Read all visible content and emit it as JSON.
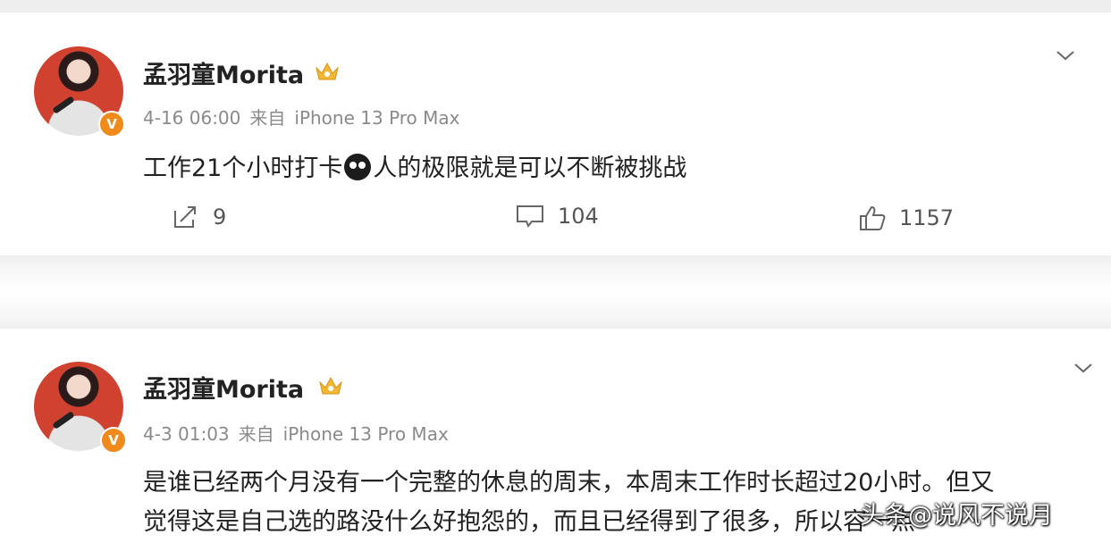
{
  "posts": [
    {
      "username": "孟羽童Morita",
      "date": "4-16 06:00",
      "source_prefix": "来自",
      "source_device": "iPhone 13 Pro Max",
      "text_before_emoji": "工作21个小时打卡",
      "emoji": "emoji-face",
      "text_after_emoji": "人的极限就是可以不断被挑战",
      "repost_count": "9",
      "comment_count": "104",
      "like_count": "1157"
    },
    {
      "username": "孟羽童Morita",
      "date": "4-3 01:03",
      "source_prefix": "来自",
      "source_device": "iPhone 13 Pro Max",
      "text_line1": "是谁已经两个月没有一个完整的休息的周末，本周末工作时长超过20小时。但又",
      "text_line2": "觉得这是自己选的路没什么好抱怨的，而且已经得到了很多，所以容一点"
    }
  ],
  "watermark": "头条@说风不说月",
  "icons": {
    "verified_badge": "v-badge-icon",
    "member_crown": "crown-icon",
    "expand": "chevron-down-icon",
    "repost": "repost-icon",
    "comment": "comment-icon",
    "like": "thumbs-up-icon"
  },
  "colors": {
    "badge": "#f08a1b",
    "crown": "#f2b632",
    "avatar_bg": "#d0412f",
    "meta_text": "#8a8a8a"
  }
}
